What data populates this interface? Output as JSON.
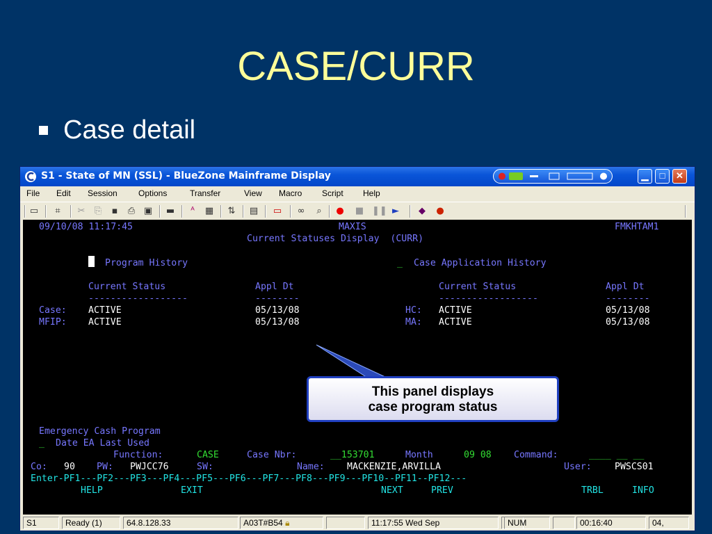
{
  "slide": {
    "title": "CASE/CURR",
    "bullet": "Case detail"
  },
  "window": {
    "title": "S1 - State of MN (SSL) - BlueZone Mainframe Display",
    "menu": [
      "File",
      "Edit",
      "Session",
      "Options",
      "Transfer",
      "View",
      "Macro",
      "Script",
      "Help"
    ]
  },
  "terminal": {
    "datetime": "09/10/08 11:17:45",
    "system": "MAXIS",
    "terminal_id": "FMKHTAM1",
    "screen_title": "Current Statuses Display  (CURR)",
    "program_history": "Program History",
    "case_app_history_cursor": "_",
    "case_app_history": "Case Application History",
    "left_headers": {
      "status": "Current Status",
      "appl_dt": "Appl Dt",
      "status_dash": "------------------",
      "dt_dash": "--------"
    },
    "right_headers": {
      "status": "Current Status",
      "appl_dt": "Appl Dt",
      "status_dash": "------------------",
      "dt_dash": "--------"
    },
    "left_rows": [
      {
        "label": "Case:",
        "status": "ACTIVE",
        "date": "05/13/08"
      },
      {
        "label": "MFIP:",
        "status": "ACTIVE",
        "date": "05/13/08"
      }
    ],
    "right_rows": [
      {
        "label": "HC:",
        "status": "ACTIVE",
        "date": "05/13/08"
      },
      {
        "label": "MA:",
        "status": "ACTIVE",
        "date": "05/13/08"
      }
    ],
    "emergency": "Emergency Cash Program",
    "date_ea_cursor": "_",
    "date_ea": "Date EA Last Used",
    "function_label": "Function:",
    "function_value": "CASE",
    "case_nbr_label": "Case Nbr:",
    "case_nbr_value": "__153701",
    "month_label": "Month",
    "month_value": "09 08",
    "command_label": "Command:",
    "command_value": "____ __ __",
    "co_label": "Co:",
    "co_value": "90",
    "pw_label": "PW:",
    "pw_value": "PWJCC76",
    "sw_label": "SW:",
    "name_label": "Name:",
    "name_value": "MACKENZIE,ARVILLA",
    "user_label": "User:",
    "user_value": "PWSCS01",
    "pf_line": "Enter-PF1---PF2---PF3---PF4---PF5---PF6---PF7---PF8---PF9---PF10--PF11--PF12---",
    "pf_help": "HELP",
    "pf_exit": "EXIT",
    "pf_next": "NEXT",
    "pf_prev": "PREV",
    "pf_trbl": "TRBL",
    "pf_info": "INFO"
  },
  "callout": {
    "line1": "This panel displays",
    "line2": "case program status"
  },
  "status_bar": {
    "session": "S1",
    "ready": "Ready (1)",
    "ip": "64.8.128.33",
    "lu": "A03T#B54",
    "time": "11:17:55 Wed Sep",
    "num": "NUM",
    "elapsed": "00:16:40",
    "pos": "04,"
  }
}
